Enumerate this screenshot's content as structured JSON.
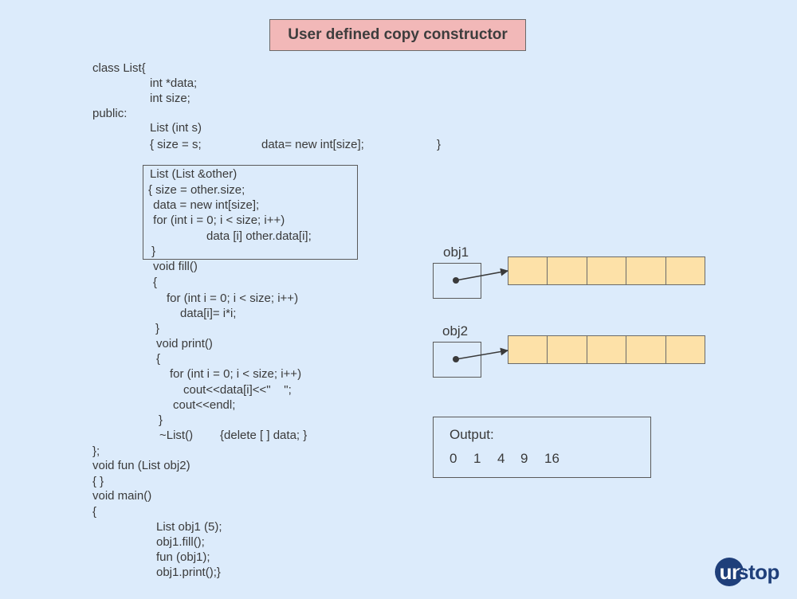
{
  "title": "User defined copy constructor",
  "code": {
    "lines": [
      "class List{",
      "int *data;",
      "int size;",
      "public:",
      "List (int s)",
      "{ size = s;",
      "data= new int[size];",
      "}",
      "List (List &other)",
      "{ size = other.size;",
      " data = new int[size];",
      " for (int i = 0; i < size; i++)",
      "data [i] other.data[i];",
      " }",
      "void fill()",
      "{",
      "for (int i = 0; i < size; i++)",
      "data[i]= i*i;",
      "}",
      "void print()",
      "{",
      "for (int i = 0; i < size; i++)",
      "cout<<data[i]<<\"    \";",
      "cout<<endl;",
      "}",
      "~List()",
      "{delete [ ] data; }",
      "};",
      "void fun (List obj2)",
      "{ }",
      "void main()",
      "{",
      "List obj1 (5);",
      "obj1.fill();",
      "fun (obj1);",
      "obj1.print();}"
    ]
  },
  "diagram": {
    "objects": [
      {
        "label": "obj1",
        "array_size": 5
      },
      {
        "label": "obj2",
        "array_size": 5
      }
    ],
    "array_fill_color": "#fde1a8"
  },
  "output": {
    "label": "Output:",
    "values": [
      "0",
      "1",
      "4",
      "9",
      "16"
    ]
  },
  "logo": {
    "text_circle": "un",
    "text_rest": "stop",
    "color": "#1f3f7a"
  }
}
